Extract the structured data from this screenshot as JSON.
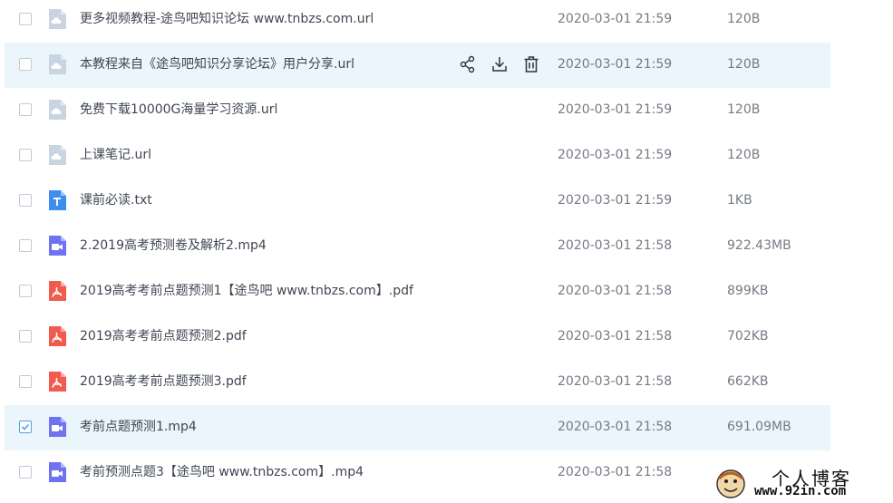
{
  "files": [
    {
      "name": "更多视频教程-途鸟吧知识论坛 www.tnbzs.com.url",
      "type": "url",
      "date": "2020-03-01 21:59",
      "size": "120B",
      "checked": false,
      "state": "normal"
    },
    {
      "name": "本教程来自《途鸟吧知识分享论坛》用户分享.url",
      "type": "url",
      "date": "2020-03-01 21:59",
      "size": "120B",
      "checked": false,
      "state": "hover"
    },
    {
      "name": "免费下载10000G海量学习资源.url",
      "type": "url",
      "date": "2020-03-01 21:59",
      "size": "120B",
      "checked": false,
      "state": "normal"
    },
    {
      "name": "上课笔记.url",
      "type": "url",
      "date": "2020-03-01 21:59",
      "size": "120B",
      "checked": false,
      "state": "normal"
    },
    {
      "name": "课前必读.txt",
      "type": "txt",
      "date": "2020-03-01 21:59",
      "size": "1KB",
      "checked": false,
      "state": "normal"
    },
    {
      "name": "2.2019高考预测卷及解析2.mp4",
      "type": "video",
      "date": "2020-03-01 21:58",
      "size": "922.43MB",
      "checked": false,
      "state": "normal"
    },
    {
      "name": "2019高考考前点题预测1【途鸟吧 www.tnbzs.com】.pdf",
      "type": "pdf",
      "date": "2020-03-01 21:58",
      "size": "899KB",
      "checked": false,
      "state": "normal"
    },
    {
      "name": "2019高考考前点题预测2.pdf",
      "type": "pdf",
      "date": "2020-03-01 21:58",
      "size": "702KB",
      "checked": false,
      "state": "normal"
    },
    {
      "name": "2019高考考前点题预测3.pdf",
      "type": "pdf",
      "date": "2020-03-01 21:58",
      "size": "662KB",
      "checked": false,
      "state": "normal"
    },
    {
      "name": "考前点题预测1.mp4",
      "type": "video",
      "date": "2020-03-01 21:58",
      "size": "691.09MB",
      "checked": true,
      "state": "selected"
    },
    {
      "name": "考前预测点题3【途鸟吧 www.tnbzs.com】.mp4",
      "type": "video",
      "date": "2020-03-01 21:58",
      "size": "",
      "checked": false,
      "state": "normal"
    }
  ],
  "row_actions": [
    {
      "icon": "share-icon"
    },
    {
      "icon": "download-icon"
    },
    {
      "icon": "delete-icon"
    }
  ],
  "watermark": {
    "title": "个人博客",
    "url": "www.92in.com"
  },
  "colors": {
    "hover_bg": "#ebf5fc",
    "url_icon": "#c8d4e0",
    "txt_icon": "#3d8eee",
    "video_icon": "#6f73f0",
    "pdf_icon": "#f25a4d",
    "check": "#4ea1eb"
  }
}
